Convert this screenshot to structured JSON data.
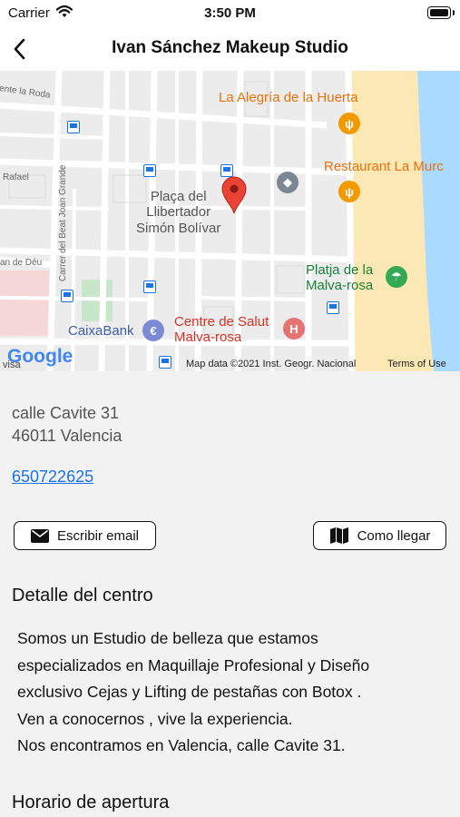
{
  "status_bar": {
    "carrier": "Carrier",
    "time": "3:50 PM"
  },
  "nav": {
    "title": "Ivan Sánchez Makeup Studio",
    "back_icon": "chevron-left-icon"
  },
  "map": {
    "labels": {
      "street_roda": "ente la Roda",
      "street_rafael": "Rafael",
      "street_deu": "an de Déu",
      "street_beat": "Carrer del Beat Joan Grande",
      "plaza": "Plaça del\nLlibertador\nSimón Bolívar",
      "alegria": "La Alegría de la Huerta",
      "restaurant": "Restaurant La Murc",
      "platja": "Platja de la\nMalva-rosa",
      "caixabank": "CaixaBank",
      "centre": "Centre de Salut\nMalva-rosa",
      "visa": "visa"
    },
    "logo": "Google",
    "attribution": "Map data ©2021 Inst. Geogr. Nacional",
    "terms": "Terms of Use",
    "colors": {
      "sea": "#aadaff",
      "beach": "#fbe8b4",
      "park": "#c8e6c9",
      "pin": "#ea4335"
    }
  },
  "address": {
    "line1": "calle Cavite 31",
    "line2": "46011 Valencia"
  },
  "phone": "650722625",
  "buttons": {
    "email": "Escribir email",
    "directions": "Como llegar"
  },
  "details": {
    "title": "Detalle del centro",
    "lines": [
      "Somos un Estudio de belleza que estamos",
      "especializados en Maquillaje Profesional y Diseño",
      "exclusivo Cejas y Lifting de pestañas con Botox .",
      "Ven a conocernos , vive la experiencia.",
      "Nos encontramos en Valencia, calle Cavite 31."
    ]
  },
  "hours": {
    "title": "Horario de apertura"
  },
  "colors": {
    "link": "#1a73e8",
    "background": "#f2f2f2"
  }
}
